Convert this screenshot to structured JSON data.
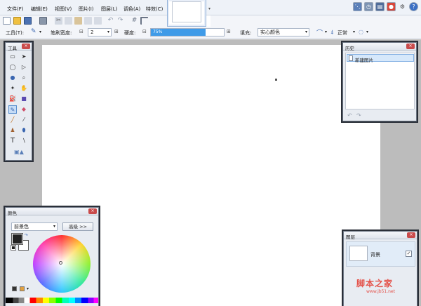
{
  "menu": [
    "文件(F)",
    "编辑(E)",
    "视图(V)",
    "图片(I)",
    "图层(L)",
    "调色(A)",
    "特效(C)"
  ],
  "toolbar": {
    "tool_label": "工具(T):",
    "brush_width_label": "笔刷宽度:",
    "brush_width_value": "2",
    "hardness_label": "硬度:",
    "hardness_value": "75%",
    "hardness_percent": 75,
    "fill_label": "填充:",
    "fill_value": "实心颜色",
    "blend_value": "正常"
  },
  "tools_panel": {
    "title": "工具"
  },
  "history_panel": {
    "title": "历史",
    "items": [
      "新建图片"
    ]
  },
  "colors_panel": {
    "title": "颜色",
    "mode_value": "前景色",
    "advanced_label": "高级 >>",
    "primary_color": "#222222",
    "secondary_color": "#ffffff"
  },
  "layers_panel": {
    "title": "图层",
    "layers": [
      {
        "name": "背景",
        "visible": true
      }
    ]
  },
  "watermark": {
    "main": "脚本之家",
    "sub": "www.jb51.net"
  },
  "icons": {
    "new": "new-file-icon",
    "open": "open-folder-icon",
    "save": "save-icon",
    "print": "print-icon",
    "cut": "cut-icon",
    "copy": "copy-icon",
    "paste": "paste-icon",
    "undo": "undo-icon",
    "redo": "redo-icon",
    "grid": "grid-icon",
    "ruler": "ruler-icon",
    "settings": "gear-icon",
    "help": "help-icon"
  }
}
